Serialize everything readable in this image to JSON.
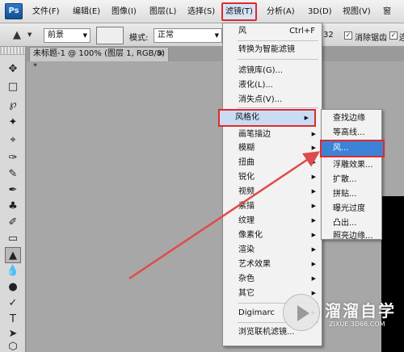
{
  "app": {
    "logo": "Ps"
  },
  "menubar": {
    "items": [
      "文件(F)",
      "编辑(E)",
      "图像(I)",
      "图层(L)",
      "选择(S)",
      "滤镜(T)",
      "分析(A)",
      "3D(D)",
      "视图(V)",
      "窗"
    ],
    "active": "滤镜(T)"
  },
  "options": {
    "tool_icon": "paint-bucket-icon",
    "fill_source": "前景",
    "mode_label": "模式:",
    "mode_value": "正常",
    "tolerance_fragment": "32",
    "antialias_label": "消除锯齿",
    "contiguous_label": "连"
  },
  "document": {
    "tab_title": "未标题-1 @ 100% (图层 1, RGB/8) *",
    "close": "×"
  },
  "toolbox": {
    "tools": [
      "move-icon",
      "marquee-icon",
      "lasso-icon",
      "magic-wand-icon",
      "crop-icon",
      "eyedropper-icon",
      "healing-brush-icon",
      "brush-icon",
      "clone-stamp-icon",
      "history-brush-icon",
      "eraser-icon",
      "paint-bucket-icon",
      "blur-icon",
      "dodge-icon",
      "pen-icon",
      "type-icon",
      "path-selection-icon",
      "shape-icon"
    ],
    "selected": "paint-bucket-icon"
  },
  "filter_menu": {
    "last_filter": "风",
    "last_filter_shortcut": "Ctrl+F",
    "convert_smart": "转换为智能滤镜",
    "gallery": "滤镜库(G)...",
    "liquify": "液化(L)...",
    "vanishing_point": "消失点(V)...",
    "submenus": [
      "风格化",
      "画笔描边",
      "模糊",
      "扭曲",
      "锐化",
      "视频",
      "素描",
      "纹理",
      "像素化",
      "渲染",
      "艺术效果",
      "杂色",
      "其它"
    ],
    "highlighted": "风格化",
    "digimarc": "Digimarc",
    "browse_online": "浏览联机滤镜..."
  },
  "stylize_menu": {
    "items": [
      "查找边缘",
      "等高线...",
      "风...",
      "浮雕效果...",
      "扩散...",
      "拼贴...",
      "曝光过度",
      "凸出...",
      "照亮边缘..."
    ],
    "highlighted": "风..."
  },
  "watermark": {
    "text": "溜溜自学",
    "url": "ZIXUE.3D66.COM"
  },
  "colors": {
    "highlight_border": "#e02a2a",
    "menu_selected": "#3c83d8",
    "annotation_arrow": "#e04a4a"
  }
}
